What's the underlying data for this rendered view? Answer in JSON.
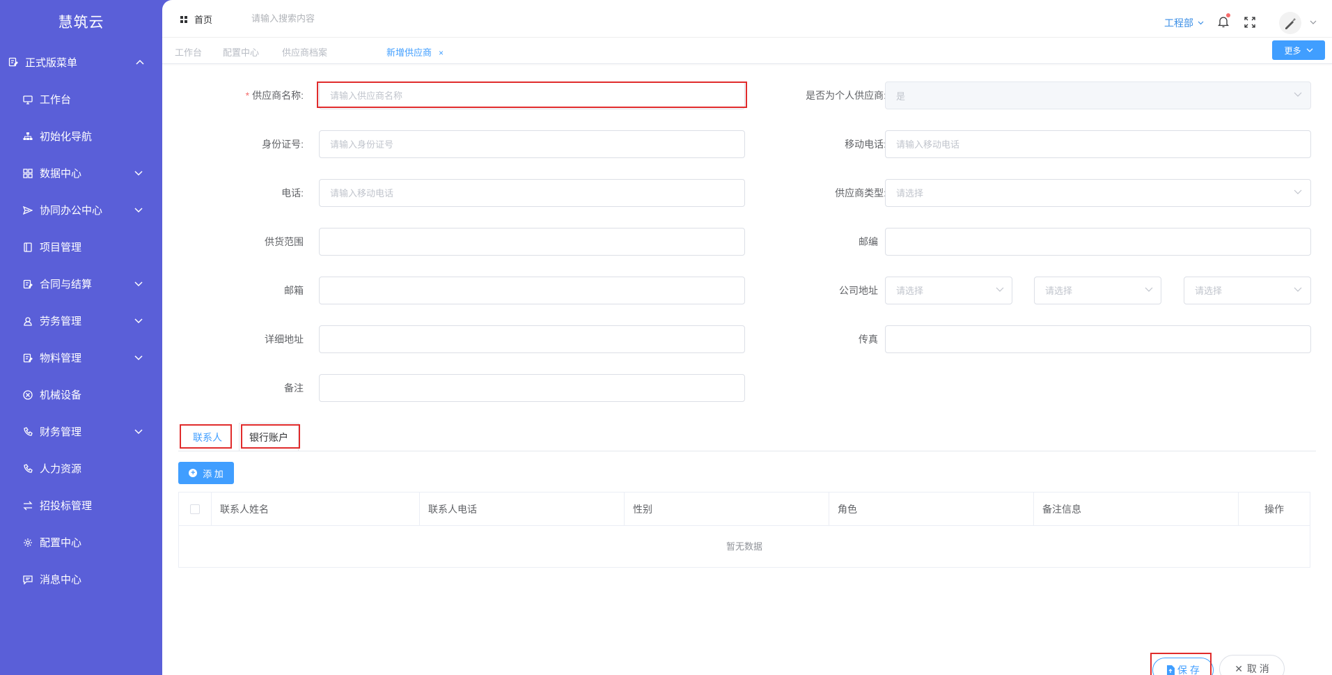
{
  "app": {
    "logo": "慧筑云"
  },
  "sidebar": {
    "group": {
      "label": "正式版菜单"
    },
    "items": [
      {
        "label": "工作台",
        "icon": "monitor-icon",
        "expandable": false
      },
      {
        "label": "初始化导航",
        "icon": "sitemap-icon",
        "expandable": false
      },
      {
        "label": "数据中心",
        "icon": "grid-icon",
        "expandable": true
      },
      {
        "label": "协同办公中心",
        "icon": "send-icon",
        "expandable": true
      },
      {
        "label": "项目管理",
        "icon": "book-icon",
        "expandable": false
      },
      {
        "label": "合同与结算",
        "icon": "edit-icon",
        "expandable": true
      },
      {
        "label": "劳务管理",
        "icon": "worker-icon",
        "expandable": true
      },
      {
        "label": "物料管理",
        "icon": "edit-icon",
        "expandable": true
      },
      {
        "label": "机械设备",
        "icon": "circle-x-icon",
        "expandable": false
      },
      {
        "label": "财务管理",
        "icon": "phone-icon",
        "expandable": true
      },
      {
        "label": "人力资源",
        "icon": "phone-icon",
        "expandable": false
      },
      {
        "label": "招投标管理",
        "icon": "swap-icon",
        "expandable": false
      },
      {
        "label": "配置中心",
        "icon": "gear-icon",
        "expandable": false
      },
      {
        "label": "消息中心",
        "icon": "message-icon",
        "expandable": false
      }
    ]
  },
  "topbar": {
    "home": "首页",
    "search_placeholder": "请输入搜索内容",
    "department": "工程部"
  },
  "tabs": {
    "items": [
      "工作台",
      "配置中心",
      "供应商档案",
      "新增供应商"
    ],
    "close": "×",
    "more": "更多"
  },
  "form": {
    "supplier_name": {
      "label": "供应商名称:",
      "placeholder": "请输入供应商名称",
      "required": "*"
    },
    "is_personal": {
      "label": "是否为个人供应商:",
      "value": "是"
    },
    "id_card": {
      "label": "身份证号:",
      "placeholder": "请输入身份证号"
    },
    "mobile": {
      "label": "移动电话:",
      "placeholder": "请输入移动电话"
    },
    "phone": {
      "label": "电话:",
      "placeholder": "请输入移动电话"
    },
    "supplier_type": {
      "label": "供应商类型:",
      "placeholder": "请选择"
    },
    "supply_scope": {
      "label": "供货范围",
      "value": ""
    },
    "postcode": {
      "label": "邮编",
      "value": ""
    },
    "email": {
      "label": "邮箱",
      "value": ""
    },
    "company_address": {
      "label": "公司地址",
      "placeholders": [
        "请选择",
        "请选择",
        "请选择"
      ]
    },
    "detail_address": {
      "label": "详细地址",
      "value": ""
    },
    "fax": {
      "label": "传真",
      "value": ""
    },
    "remark": {
      "label": "备注",
      "value": ""
    }
  },
  "subtabs": {
    "contact": "联系人",
    "bank": "银行账户"
  },
  "add_button": {
    "label": "添 加"
  },
  "table": {
    "columns": [
      "联系人姓名",
      "联系人电话",
      "性别",
      "角色",
      "备注信息",
      "操作"
    ],
    "empty": "暂无数据"
  },
  "footer": {
    "save": "保 存",
    "cancel": "取 消"
  },
  "colors": {
    "sidebar": "#5a5fd8",
    "accent": "#409eff",
    "required": "#f56c6c",
    "highlight": "#e02b2b"
  }
}
